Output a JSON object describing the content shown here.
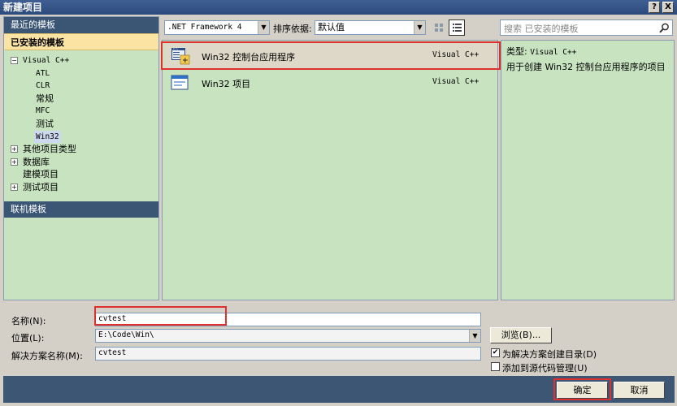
{
  "window": {
    "title": "新建项目",
    "help_glyph": "?",
    "close_glyph": "X"
  },
  "left": {
    "recent_header": "最近的模板",
    "installed_header": "已安装的模板",
    "online_header": "联机模板",
    "tree": {
      "root": {
        "label": "Visual C++",
        "expander": "−"
      },
      "children": [
        "ATL",
        "CLR",
        "常规",
        "MFC",
        "测试",
        "Win32"
      ],
      "others": [
        {
          "label": "其他项目类型",
          "expander": "+"
        },
        {
          "label": "数据库",
          "expander": "+"
        },
        {
          "label": "建模项目",
          "expander": ""
        },
        {
          "label": "测试项目",
          "expander": "+"
        }
      ]
    }
  },
  "toolbar": {
    "framework": ".NET Framework 4",
    "sort_label": "排序依据:",
    "sort_value": "默认值",
    "search_placeholder": "搜索 已安装的模板"
  },
  "templates": [
    {
      "name": "Win32 控制台应用程序",
      "lang": "Visual C++",
      "icon": "console-app-icon",
      "selected": true
    },
    {
      "name": "Win32 项目",
      "lang": "Visual C++",
      "icon": "window-app-icon",
      "selected": false
    }
  ],
  "description": {
    "type_label": "类型:",
    "type_value": "Visual C++",
    "text": "用于创建 Win32 控制台应用程序的项目"
  },
  "form": {
    "name_label": "名称(N):",
    "name_value": "cvtest",
    "location_label": "位置(L):",
    "location_value": "E:\\Code\\Win\\",
    "solution_label": "解决方案名称(M):",
    "solution_value": "cvtest",
    "browse_label": "浏览(B)...",
    "create_dir_label": "为解决方案创建目录(D)",
    "create_dir_checked": true,
    "source_control_label": "添加到源代码管理(U)",
    "source_control_checked": false
  },
  "buttons": {
    "ok": "确定",
    "cancel": "取消"
  },
  "colors": {
    "highlight": "#e0302e",
    "panel": "#c8e3c0",
    "header": "#3b5675",
    "selected_header": "#fbe4a3"
  }
}
